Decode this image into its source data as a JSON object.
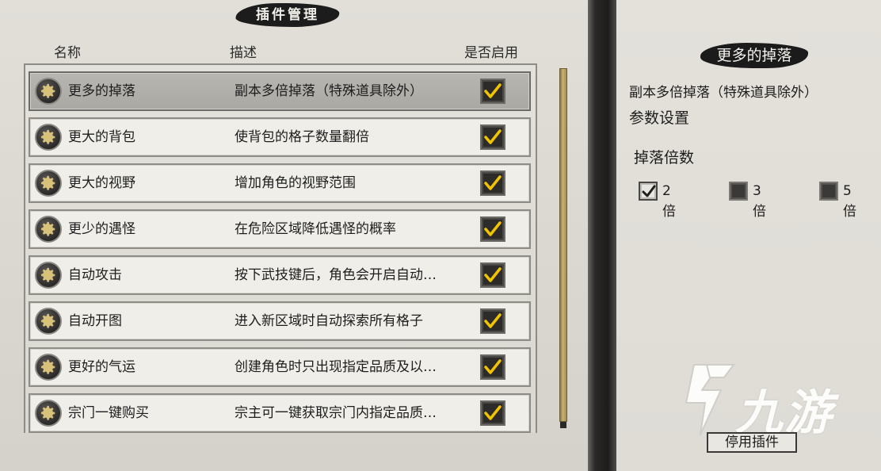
{
  "header": {
    "title": "插件管理"
  },
  "columns": {
    "name": "名称",
    "desc": "描述",
    "enabled": "是否启用"
  },
  "plugins": [
    {
      "name": "更多的掉落",
      "desc": "副本多倍掉落（特殊道具除外）",
      "enabled": true,
      "selected": true
    },
    {
      "name": "更大的背包",
      "desc": "使背包的格子数量翻倍",
      "enabled": true
    },
    {
      "name": "更大的视野",
      "desc": "增加角色的视野范围",
      "enabled": true
    },
    {
      "name": "更少的遇怪",
      "desc": "在危险区域降低遇怪的概率",
      "enabled": true
    },
    {
      "name": "自动攻击",
      "desc": "按下武技键后，角色会开启自动…",
      "enabled": true
    },
    {
      "name": "自动开图",
      "desc": "进入新区域时自动探索所有格子",
      "enabled": true
    },
    {
      "name": "更好的气运",
      "desc": "创建角色时只出现指定品质及以…",
      "enabled": true
    },
    {
      "name": "宗门一键购买",
      "desc": "宗主可一键获取宗门内指定品质…",
      "enabled": true
    }
  ],
  "detail": {
    "title": "更多的掉落",
    "description": "副本多倍掉落（特殊道具除外）",
    "params_heading": "参数设置",
    "multiplier_heading": "掉落倍数",
    "options": [
      {
        "label": "2倍",
        "checked": true
      },
      {
        "label": "3倍",
        "checked": false
      },
      {
        "label": "5倍",
        "checked": false
      }
    ],
    "disable_button": "停用插件"
  },
  "watermark": {
    "text": "九游",
    "icon": "jiuyou-logo-icon"
  },
  "icons": {
    "row_icon": "gear-icon",
    "check_icon": "checkmark-icon"
  },
  "colors": {
    "check_yellow": "#f2c400",
    "selected_row": "#b0aea9"
  }
}
